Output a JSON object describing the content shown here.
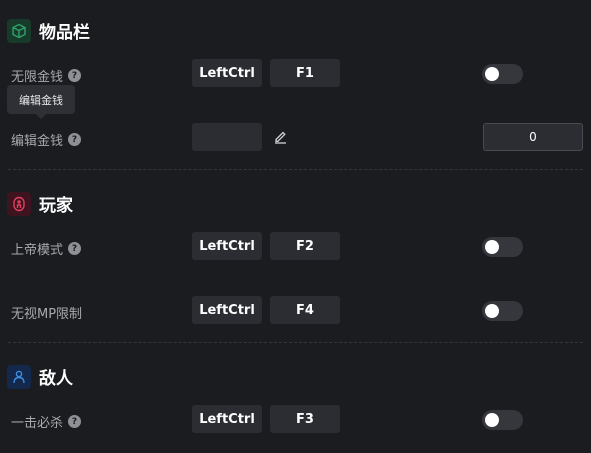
{
  "sections": {
    "inventory": {
      "title": "物品栏",
      "icon": "cube-icon",
      "icon_color": "#2fa36b",
      "icon_bg": "#173a2a",
      "rows": {
        "infinite_money": {
          "label": "无限金钱",
          "help": "?",
          "key1": "LeftCtrl",
          "key2": "F1",
          "toggle": false
        },
        "edit_money": {
          "label": "编辑金钱",
          "help": "?",
          "tooltip": "编辑金钱",
          "value": "0"
        }
      }
    },
    "player": {
      "title": "玩家",
      "icon": "person-badge-icon",
      "icon_color": "#e0405d",
      "icon_bg": "#3d1420",
      "rows": {
        "god_mode": {
          "label": "上帝模式",
          "help": "?",
          "key1": "LeftCtrl",
          "key2": "F2",
          "toggle": false
        },
        "ignore_mp": {
          "label": "无视MP限制",
          "key1": "LeftCtrl",
          "key2": "F4",
          "toggle": false
        }
      }
    },
    "enemy": {
      "title": "敌人",
      "icon": "person-icon",
      "icon_color": "#3d8de0",
      "icon_bg": "#13284a",
      "rows": {
        "one_hit_kill": {
          "label": "一击必杀",
          "help": "?",
          "key1": "LeftCtrl",
          "key2": "F3",
          "toggle": false
        }
      }
    }
  }
}
